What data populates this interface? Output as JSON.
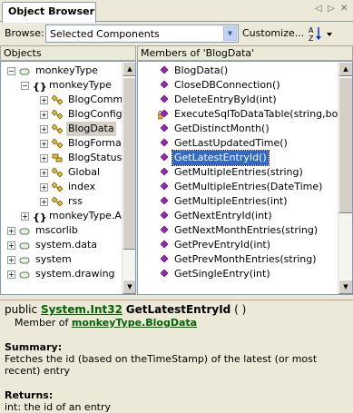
{
  "tab": {
    "title": "Object Browser"
  },
  "toolbar": {
    "browse_label": "Browse:",
    "browse_value": "Selected Components",
    "customize_label": "Customize..."
  },
  "objects": {
    "header": "Objects",
    "items": [
      {
        "label": "monkeyType",
        "level": 0,
        "expander": "−",
        "icon": "assembly-icon"
      },
      {
        "label": "monkeyType",
        "level": 1,
        "expander": "−",
        "icon": "namespace-icon"
      },
      {
        "label": "BlogComme",
        "level": 2,
        "expander": "+",
        "icon": "class-icon"
      },
      {
        "label": "BlogConfig",
        "level": 2,
        "expander": "+",
        "icon": "class-icon"
      },
      {
        "label": "BlogData",
        "level": 2,
        "expander": "+",
        "icon": "class-icon",
        "selected": true
      },
      {
        "label": "BlogFormat",
        "level": 2,
        "expander": "+",
        "icon": "class-icon"
      },
      {
        "label": "BlogStatus",
        "level": 2,
        "expander": "+",
        "icon": "enum-icon"
      },
      {
        "label": "Global",
        "level": 2,
        "expander": "+",
        "icon": "class-icon"
      },
      {
        "label": "index",
        "level": 2,
        "expander": "+",
        "icon": "class-icon"
      },
      {
        "label": "rss",
        "level": 2,
        "expander": "+",
        "icon": "class-icon"
      },
      {
        "label": "monkeyType.A",
        "level": 1,
        "expander": "+",
        "icon": "namespace-icon"
      },
      {
        "label": "mscorlib",
        "level": 0,
        "expander": "+",
        "icon": "assembly-icon"
      },
      {
        "label": "system.data",
        "level": 0,
        "expander": "+",
        "icon": "assembly-icon"
      },
      {
        "label": "system",
        "level": 0,
        "expander": "+",
        "icon": "assembly-icon"
      },
      {
        "label": "system.drawing",
        "level": 0,
        "expander": "+",
        "icon": "assembly-icon"
      }
    ]
  },
  "members": {
    "header": "Members of 'BlogData'",
    "items": [
      {
        "label": "BlogData()",
        "locked": false
      },
      {
        "label": "CloseDBConnection()",
        "locked": false
      },
      {
        "label": "DeleteEntryById(int)",
        "locked": false
      },
      {
        "label": "ExecuteSqlToDataTable(string,bool)",
        "locked": true
      },
      {
        "label": "GetDistinctMonth()",
        "locked": false
      },
      {
        "label": "GetLastUpdatedTime()",
        "locked": false
      },
      {
        "label": "GetLatestEntryId()",
        "locked": false,
        "selected": true
      },
      {
        "label": "GetMultipleEntries(string)",
        "locked": false
      },
      {
        "label": "GetMultipleEntries(DateTime)",
        "locked": false
      },
      {
        "label": "GetMultipleEntries(int)",
        "locked": false
      },
      {
        "label": "GetNextEntryId(int)",
        "locked": false
      },
      {
        "label": "GetNextMonthEntries(string)",
        "locked": false
      },
      {
        "label": "GetPrevEntryId(int)",
        "locked": false
      },
      {
        "label": "GetPrevMonthEntries(string)",
        "locked": false
      },
      {
        "label": "GetSingleEntry(int)",
        "locked": false
      }
    ]
  },
  "description": {
    "prefix": "public",
    "return_type": "System.Int32",
    "method_name": "GetLatestEntryId",
    "params": "( )",
    "member_of_label": "Member of",
    "member_of": "monkeyType.BlogData",
    "summary_label": "Summary:",
    "summary_text": "Fetches the id (based on theTimeStamp) of the latest (or most recent) entry",
    "returns_label": "Returns:",
    "returns_text": "int: the id of an entry"
  },
  "colors": {
    "selection": "#316ac5",
    "link": "#006400",
    "member_icon": "#a020c0"
  }
}
